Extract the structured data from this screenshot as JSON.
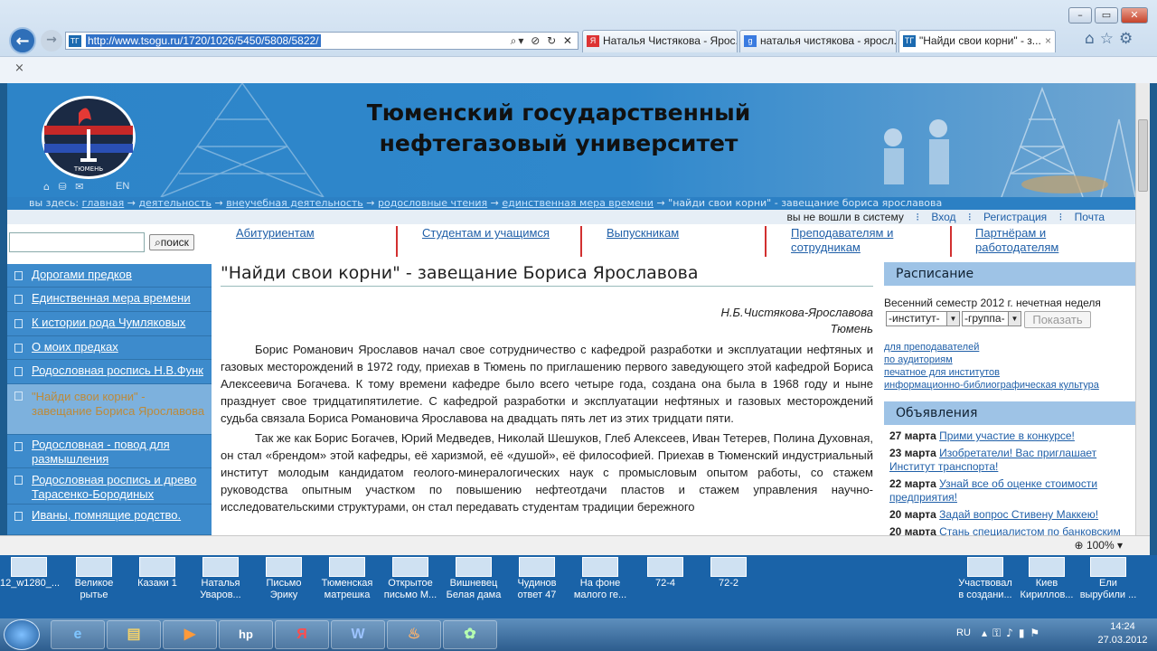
{
  "browser": {
    "url": "http://www.tsogu.ru/1720/1026/5450/5808/5822/",
    "tabs": [
      "Наталья Чистякова - Ярос...",
      "наталья чистякова - яросл...",
      "\"Найди свои корни\" - з..."
    ],
    "close_tab": "×",
    "cmd_close": "×",
    "zoom": "100%"
  },
  "header": {
    "title_line1": "Тюменский государственный",
    "title_line2": "нефтегазовый университет",
    "logo_caption": "ТЮМЕНЬ",
    "lang": "EN"
  },
  "breadcrumb": {
    "prefix": "вы здесь:",
    "items": [
      "главная",
      "деятельность",
      "внеучебная деятельность",
      "родословные чтения",
      "единственная мера времени"
    ],
    "current": "\"найди свои корни\" - завещание бориса ярославова",
    "arrow": "→"
  },
  "login": {
    "status": "вы не вошли в систему",
    "enter": "Вход",
    "register": "Регистрация",
    "mail": "Почта"
  },
  "search": {
    "button": "поиск",
    "value": ""
  },
  "topnav": [
    "Абитуриентам",
    "Студентам и учащимся",
    "Выпускникам",
    "Преподавателям и сотрудникам",
    "Партнёрам и работодателям"
  ],
  "sidebar": [
    {
      "label": "Дорогами предков"
    },
    {
      "label": "Единственная мера времени"
    },
    {
      "label": "К истории рода Чумляковых"
    },
    {
      "label": "О моих предках"
    },
    {
      "label": "Родословная роспись Н.В.Функ"
    },
    {
      "label": "\"Найди свои корни\" - завещание Бориса Ярославова"
    },
    {
      "label": "Родословная - повод для размышления"
    },
    {
      "label": "Родословная роспись и древо Тарасенко-Бородиных"
    },
    {
      "label": "Иваны, помнящие родство."
    }
  ],
  "article": {
    "title": "\"Найди свои корни\" - завещание Бориса Ярославова",
    "author": "Н.Б.Чистякова-Ярославова",
    "city": "Тюмень",
    "p1": "Борис Романович Ярославов начал свое сотрудничество с кафедрой разработки и эксплуатации нефтяных и газовых месторождений в 1972 году, приехав в Тюмень по приглашению первого заведующего этой кафедрой Бориса Алексеевича Богачева. К тому времени кафедре было всего четыре года, создана она была в 1968 году и ныне празднует свое тридцатипятилетие. С кафедрой разработки и эксплуатации нефтяных и газовых месторождений судьба связала Бориса Романовича Ярославова на двадцать пять лет из этих тридцати пяти.",
    "p2": "Так же как Борис Богачев, Юрий Медведев, Николай Шешуков, Глеб Алексеев, Иван Тетерев, Полина Духовная, он стал «брендом» этой кафедры, её харизмой, её «душой», её философией. Приехав в Тюменский индустриальный институт молодым кандидатом геолого-минералогических наук с промысловым опытом работы, со стажем руководства опытным участком по повышению нефтеотдачи пластов и стажем управления научно-исследовательскими структурами, он стал передавать студентам традиции бережного"
  },
  "schedule": {
    "title": "Расписание",
    "semester": "Весенний семестр 2012 г. нечетная неделя",
    "institute": "-институт-",
    "group": "-группа-",
    "show": "Показать",
    "links": [
      "для преподавателей",
      "по аудиториям",
      "печатное для институтов",
      "информационно-библиографическая культура"
    ]
  },
  "news": {
    "title": "Объявления",
    "items": [
      {
        "date": "27 марта",
        "text": "Прими участие в конкурсе!"
      },
      {
        "date": "23 марта",
        "text": "Изобретатели! Вас приглашает Институт транспорта!"
      },
      {
        "date": "22 марта",
        "text": "Узнай все об оценке стоимости предприятия!"
      },
      {
        "date": "20 марта",
        "text": "Задай вопрос Стивену Маккею!"
      },
      {
        "date": "20 марта",
        "text": "Стань специалистом по банковским услугам!"
      }
    ]
  },
  "desktop": [
    {
      "label": "12_w1280_..."
    },
    {
      "label": "Великое рытье"
    },
    {
      "label": "Казаки 1"
    },
    {
      "label": "Наталья Уваров..."
    },
    {
      "label": "Письмо Эрику"
    },
    {
      "label": "Тюменская матрешка"
    },
    {
      "label": "Открытое письмо М..."
    },
    {
      "label": "Вишневец Белая дама"
    },
    {
      "label": "Чудинов ответ 47"
    },
    {
      "label": "На фоне малого ге..."
    },
    {
      "label": "72-4"
    },
    {
      "label": "72-2"
    },
    {
      "label": "Участвовал в создани..."
    },
    {
      "label": "Киев Кириллов..."
    },
    {
      "label": "Ели вырубили ..."
    }
  ],
  "taskbar": {
    "lang": "RU",
    "time": "14:24",
    "date": "27.03.2012",
    "apps": [
      "e",
      "▤",
      "▶",
      "hp",
      "Я",
      "W",
      "♨",
      "✿"
    ]
  }
}
